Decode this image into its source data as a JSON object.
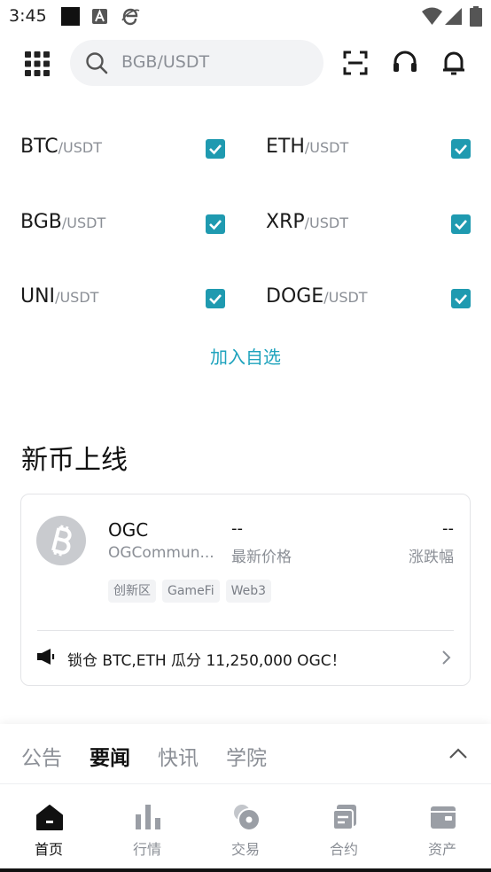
{
  "status_bar": {
    "time": "3:45"
  },
  "header": {
    "search_placeholder": "BGB/USDT"
  },
  "pairs": [
    {
      "base": "BTC",
      "quote": "/USDT",
      "checked": true
    },
    {
      "base": "ETH",
      "quote": "/USDT",
      "checked": true
    },
    {
      "base": "BGB",
      "quote": "/USDT",
      "checked": true
    },
    {
      "base": "XRP",
      "quote": "/USDT",
      "checked": true
    },
    {
      "base": "UNI",
      "quote": "/USDT",
      "checked": true
    },
    {
      "base": "DOGE",
      "quote": "/USDT",
      "checked": true
    }
  ],
  "add_favorites_label": "加入自选",
  "new_listing": {
    "title": "新币上线",
    "coin": {
      "symbol": "OGC",
      "name": "OGCommun...",
      "price": "--",
      "price_label": "最新价格",
      "change": "--",
      "change_label": "涨跌幅",
      "tags": [
        "创新区",
        "GameFi",
        "Web3"
      ]
    },
    "announcement": "锁仓 BTC,ETH 瓜分 11,250,000 OGC！"
  },
  "news_tabs": [
    {
      "label": "公告",
      "active": false
    },
    {
      "label": "要闻",
      "active": true
    },
    {
      "label": "快讯",
      "active": false
    },
    {
      "label": "学院",
      "active": false
    }
  ],
  "bottom_nav": [
    {
      "label": "首页",
      "icon": "home-icon",
      "active": true
    },
    {
      "label": "行情",
      "icon": "chart-bars-icon",
      "active": false
    },
    {
      "label": "交易",
      "icon": "trade-icon",
      "active": false
    },
    {
      "label": "合约",
      "icon": "contract-icon",
      "active": false
    },
    {
      "label": "资产",
      "icon": "wallet-icon",
      "active": false
    }
  ],
  "colors": {
    "accent": "#1f9ab0",
    "link": "#1fa3bd",
    "muted": "#8b8f96"
  }
}
